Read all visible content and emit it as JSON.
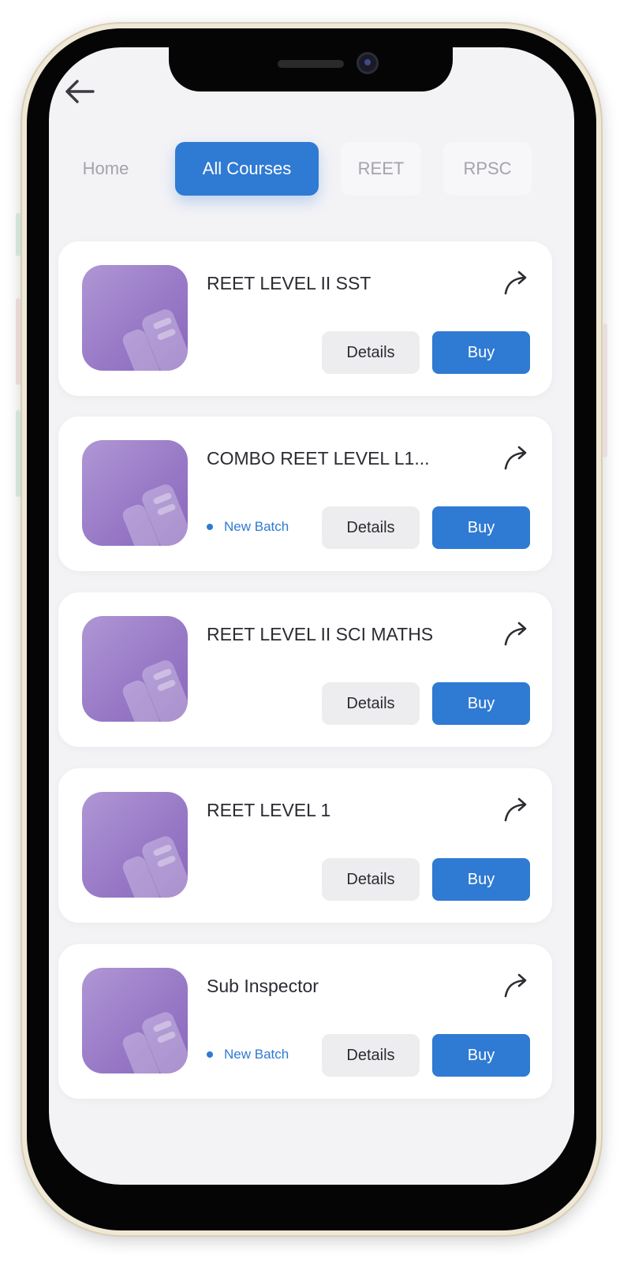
{
  "nav": {
    "back_icon": "arrow-left-icon",
    "tabs": [
      {
        "label": "Home",
        "active": false
      },
      {
        "label": "All Courses",
        "active": true
      },
      {
        "label": "REET",
        "active": false
      },
      {
        "label": "RPSC",
        "active": false
      }
    ]
  },
  "courses": [
    {
      "title": "REET LEVEL II SST",
      "badge": "",
      "details_label": "Details",
      "buy_label": "Buy"
    },
    {
      "title": "COMBO REET LEVEL L1...",
      "badge": "New Batch",
      "details_label": "Details",
      "buy_label": "Buy"
    },
    {
      "title": "REET LEVEL II SCI MATHS",
      "badge": "",
      "details_label": "Details",
      "buy_label": "Buy"
    },
    {
      "title": "REET LEVEL 1",
      "badge": "",
      "details_label": "Details",
      "buy_label": "Buy"
    },
    {
      "title": "Sub Inspector",
      "badge": "New Batch",
      "details_label": "Details",
      "buy_label": "Buy"
    }
  ],
  "colors": {
    "accent": "#2f7ad3",
    "screen_bg": "#f3f3f6",
    "card_bg": "#ffffff",
    "thumb_purple": "#9a7cc8",
    "details_bg": "#ededf0"
  },
  "icons": {
    "share": "share-arrow-icon",
    "course_thumb": "book-icon"
  }
}
